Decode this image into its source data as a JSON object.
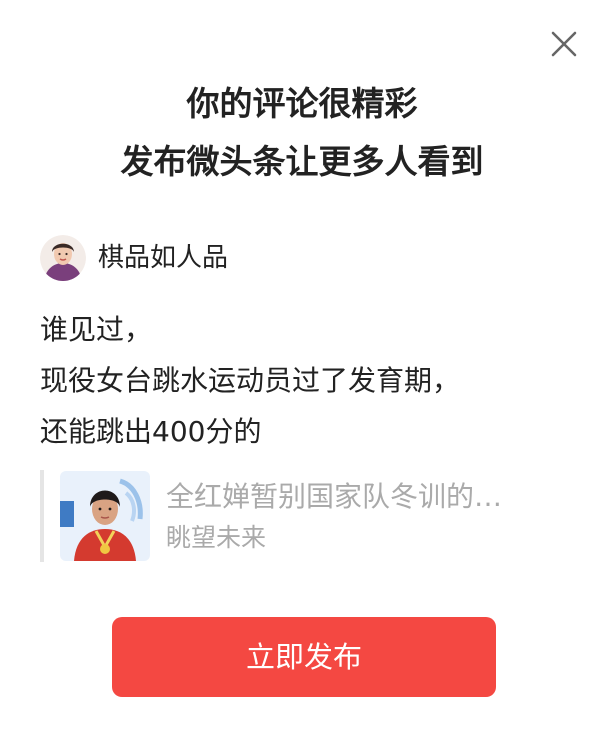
{
  "dialog": {
    "title_line1": "你的评论很精彩",
    "title_line2": "发布微头条让更多人看到",
    "close_icon": "close-icon"
  },
  "author": {
    "name": "棋品如人品",
    "avatar_icon": "user-avatar"
  },
  "comment": {
    "lines": [
      "谁见过，",
      "现役女台跳水运动员过了发育期，",
      "还能跳出400分的"
    ]
  },
  "quote": {
    "title": "全红婵暂别国家队冬训的…",
    "author": "眺望未来",
    "thumbnail_icon": "article-thumbnail"
  },
  "actions": {
    "publish_label": "立即发布"
  },
  "colors": {
    "primary": "#f44842",
    "text": "#222222",
    "muted": "#aaaaaa",
    "quote_bar": "#e5e5e5"
  }
}
